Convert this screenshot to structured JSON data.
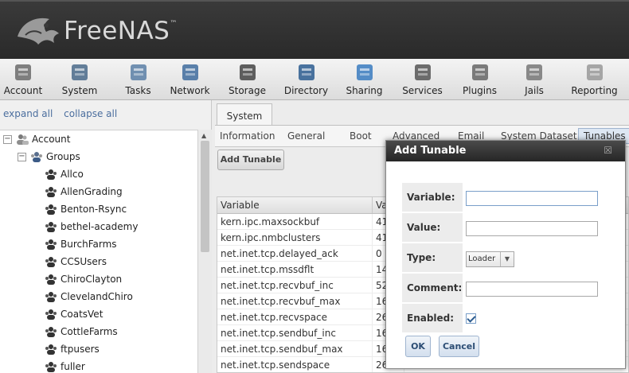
{
  "header": {
    "brand": "FreeNAS",
    "trademark": "™"
  },
  "toolbar": [
    {
      "label": "Account",
      "icon": "account-icon"
    },
    {
      "label": "System",
      "icon": "system-icon"
    },
    {
      "label": "Tasks",
      "icon": "tasks-icon"
    },
    {
      "label": "Network",
      "icon": "network-icon"
    },
    {
      "label": "Storage",
      "icon": "storage-icon"
    },
    {
      "label": "Directory",
      "icon": "directory-icon"
    },
    {
      "label": "Sharing",
      "icon": "sharing-icon"
    },
    {
      "label": "Services",
      "icon": "services-icon"
    },
    {
      "label": "Plugins",
      "icon": "plugins-icon"
    },
    {
      "label": "Jails",
      "icon": "jails-icon"
    },
    {
      "label": "Reporting",
      "icon": "reporting-icon"
    }
  ],
  "tree": {
    "expand_all": "expand all",
    "collapse_all": "collapse all",
    "root": "Account",
    "root_toggle": "−",
    "groups_label": "Groups",
    "groups_toggle": "−",
    "groups": [
      "Allco",
      "AllenGrading",
      "Benton-Rsync",
      "bethel-academy",
      "BurchFarms",
      "CCSUsers",
      "ChiroClayton",
      "ClevelandChiro",
      "CoatsVet",
      "CottleFarms",
      "ftpusers",
      "fuller"
    ]
  },
  "main": {
    "tab": "System",
    "subtabs": [
      "Information",
      "General",
      "Boot",
      "Advanced",
      "Email",
      "System Dataset",
      "Tunables"
    ],
    "active_subtab": "Tunables",
    "add_button": "Add Tunable",
    "grid": {
      "columns": [
        "Variable",
        "Va"
      ],
      "rows": [
        [
          "kern.ipc.maxsockbuf",
          "41"
        ],
        [
          "kern.ipc.nmbclusters",
          "41"
        ],
        [
          "net.inet.tcp.delayed_ack",
          "0"
        ],
        [
          "net.inet.tcp.mssdflt",
          "14"
        ],
        [
          "net.inet.tcp.recvbuf_inc",
          "52"
        ],
        [
          "net.inet.tcp.recvbuf_max",
          "16"
        ],
        [
          "net.inet.tcp.recvspace",
          "26"
        ],
        [
          "net.inet.tcp.sendbuf_inc",
          "16"
        ],
        [
          "net.inet.tcp.sendbuf_max",
          "16"
        ],
        [
          "net.inet.tcp.sendspace",
          "26"
        ]
      ]
    }
  },
  "dialog": {
    "title": "Add Tunable",
    "close": "☒",
    "fields": {
      "variable_label": "Variable:",
      "variable_value": "",
      "value_label": "Value:",
      "value_value": "",
      "type_label": "Type:",
      "type_value": "Loader",
      "comment_label": "Comment:",
      "comment_value": "",
      "enabled_label": "Enabled:",
      "enabled_checked": true
    },
    "ok": "OK",
    "cancel": "Cancel"
  }
}
